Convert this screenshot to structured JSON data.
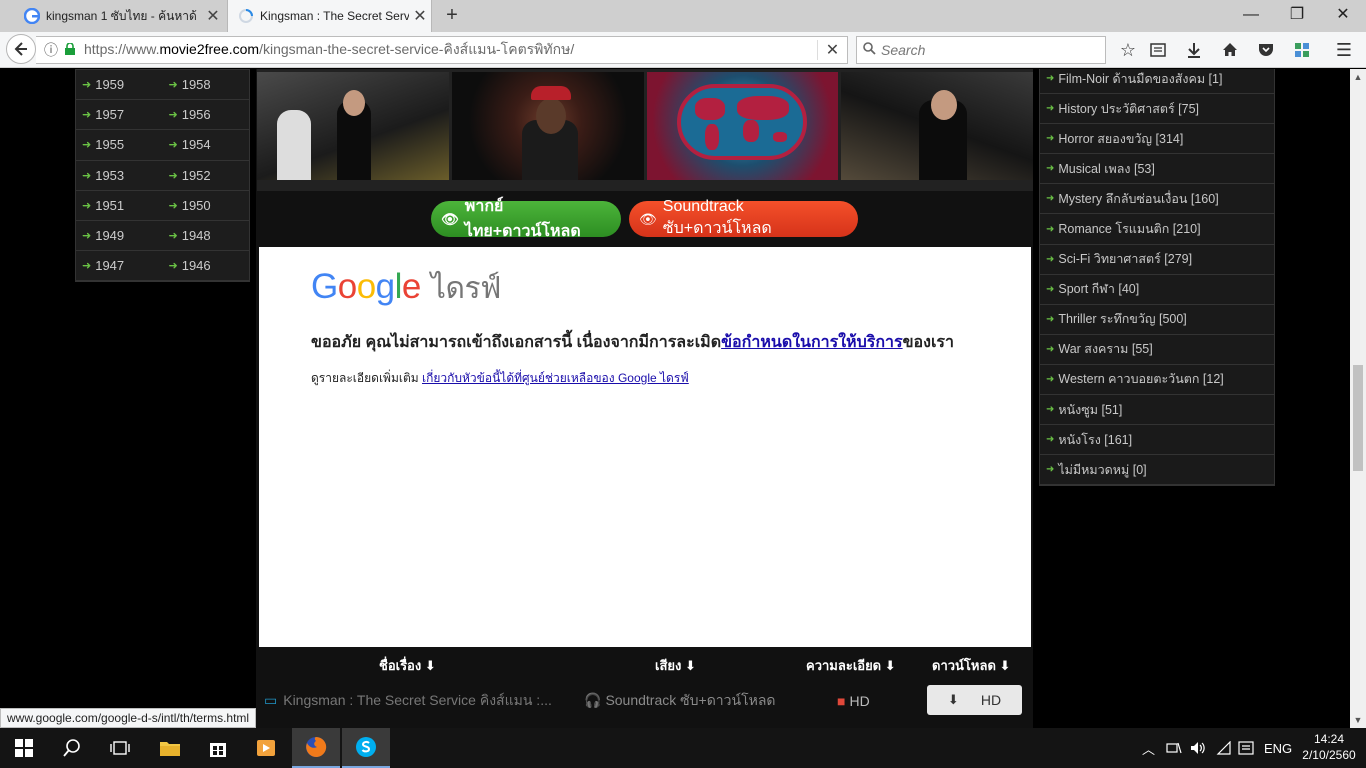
{
  "browser": {
    "tabs": [
      {
        "title": "kingsman 1 ซับไทย - ค้นหาด้",
        "active": false
      },
      {
        "title": "Kingsman : The Secret Servic",
        "active": true
      }
    ],
    "new_tab": "+",
    "window_controls": {
      "minimize": "—",
      "restore": "❐",
      "close": "✕"
    },
    "url_prefix": "https://www.",
    "url_domain": "movie2free.com",
    "url_path": "/kingsman-the-secret-service-คิงส์แมน-โคตรพิทักษ/",
    "search_placeholder": "Search"
  },
  "years": [
    [
      "1959",
      "1958"
    ],
    [
      "1957",
      "1956"
    ],
    [
      "1955",
      "1954"
    ],
    [
      "1953",
      "1952"
    ],
    [
      "1951",
      "1950"
    ],
    [
      "1949",
      "1948"
    ],
    [
      "1947",
      "1946"
    ]
  ],
  "buttons": {
    "thai_dub": "พากย์ไทย+ดาวน์โหลด",
    "soundtrack": "Soundtrack ซับ+ดาวน์โหลด"
  },
  "gdrive": {
    "logo_letters": [
      "G",
      "o",
      "o",
      "g",
      "l",
      "e"
    ],
    "product": "ไดรฟ์",
    "message_pre": "ขออภัย คุณไม่สามารถเข้าถึงเอกสารนี้ เนื่องจากมีการละเมิด",
    "message_link": "ข้อกำหนดในการให้บริการ",
    "message_post": "ของเรา",
    "sub_pre": "ดูรายละเอียดเพิ่มเติม ",
    "sub_link": "เกี่ยวกับหัวข้อนี้ได้ที่ศูนย์ช่วยเหลือของ Google ไดรฟ์"
  },
  "download_table": {
    "headers": {
      "title": "ชื่อเรื่อง",
      "audio": "เสียง",
      "resolution": "ความละเอียด",
      "download": "ดาวน์โหลด"
    },
    "row": {
      "title": "Kingsman : The Secret Service คิงส์แมน :...",
      "audio": "Soundtrack ซับ+ดาวน์โหลด",
      "resolution": "HD",
      "download": "HD"
    }
  },
  "genres": [
    "Film-Noir ด้านมืดของสังคม [1]",
    "History ประวัติศาสตร์ [75]",
    "Horror สยองขวัญ [314]",
    "Musical เพลง [53]",
    "Mystery ลึกลับซ่อนเงื่อน [160]",
    "Romance โรแมนติก [210]",
    "Sci-Fi วิทยาศาสตร์ [279]",
    "Sport กีฬา [40]",
    "Thriller ระทึกขวัญ [500]",
    "War สงคราม [55]",
    "Western คาวบอยตะวันตก [12]",
    "หนังซูม [51]",
    "หนังโรง [161]",
    "ไม่มีหมวดหมู่ [0]"
  ],
  "status_link": "www.google.com/google-d-s/intl/th/terms.html",
  "taskbar": {
    "language": "ENG",
    "time": "14:24",
    "date": "2/10/2560"
  },
  "colors": {
    "accent_green": "#6ac145",
    "button_green": "#3ca32e",
    "button_red": "#e8411f",
    "link_blue": "#1a0dab"
  }
}
